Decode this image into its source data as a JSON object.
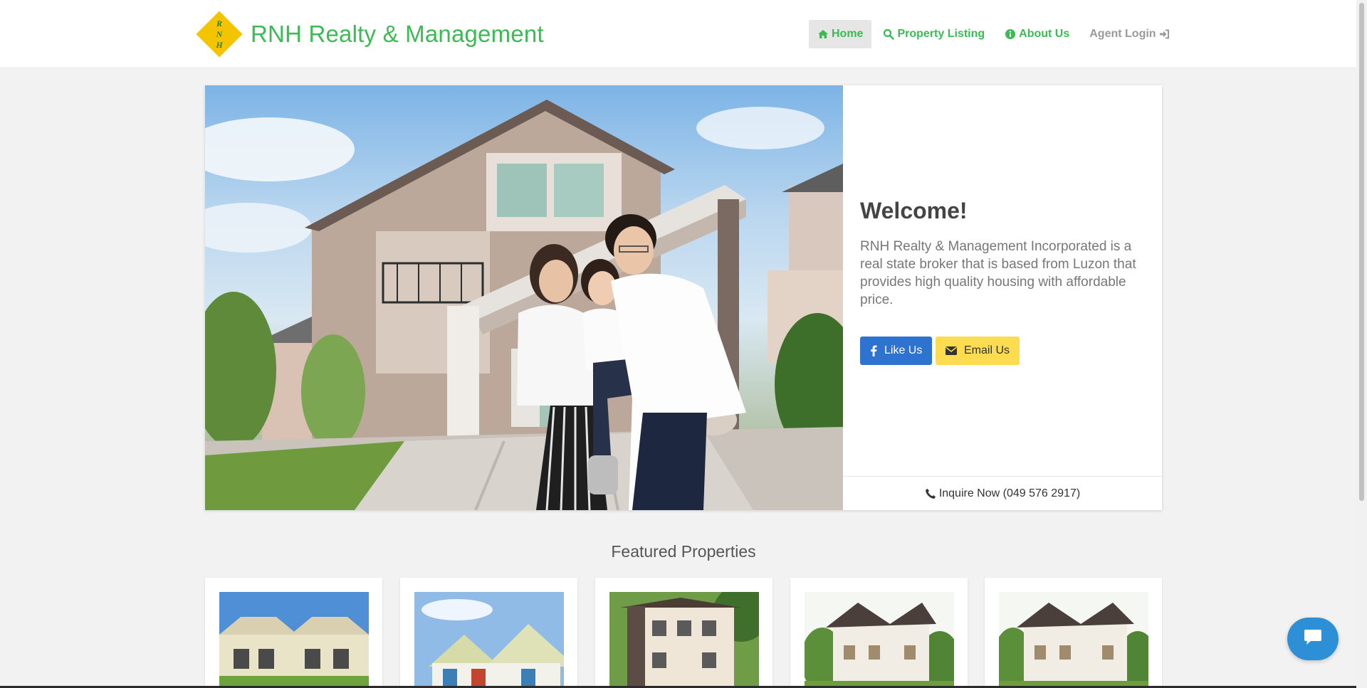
{
  "brand": {
    "name": "RNH Realty & Management",
    "logo_letters": [
      "R",
      "N",
      "H"
    ]
  },
  "nav": {
    "items": [
      {
        "label": "Home",
        "icon": "home-icon",
        "active": true
      },
      {
        "label": "Property Listing",
        "icon": "search-icon"
      },
      {
        "label": "About Us",
        "icon": "info-icon"
      },
      {
        "label": "Agent Login",
        "icon": "sign-in-icon"
      }
    ]
  },
  "hero": {
    "title": "Welcome!",
    "description": "RNH Realty & Management Incorporated is a real state broker that is based from Luzon that provides high quality housing with affordable price.",
    "like_label": "Like Us",
    "email_label": "Email Us",
    "inquire_label": "Inquire Now (049 576 2917)"
  },
  "featured": {
    "title": "Featured Properties",
    "cards": [
      {
        "name": "property-card-1"
      },
      {
        "name": "property-card-2"
      },
      {
        "name": "property-card-3"
      },
      {
        "name": "property-card-4"
      },
      {
        "name": "property-card-5"
      }
    ]
  },
  "colors": {
    "brand_green": "#3cba54",
    "logo_yellow": "#f5c400",
    "facebook_blue": "#2f73d1",
    "email_yellow": "#fddc4f",
    "chat_blue": "#2d8fd6"
  }
}
